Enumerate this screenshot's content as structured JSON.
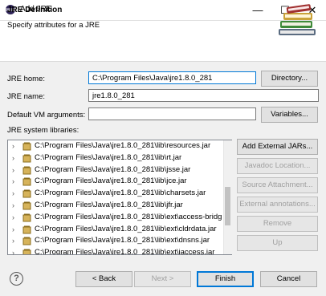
{
  "window": {
    "title": "Add JRE",
    "minimize_glyph": "—",
    "maximize_glyph": "☐",
    "close_glyph": "✕"
  },
  "header": {
    "title": "JRE Definition",
    "subtitle": "Specify attributes for a JRE",
    "icon": "library-books-icon"
  },
  "form": {
    "jre_home_label": "JRE home:",
    "jre_home_value": "C:\\Program Files\\Java\\jre1.8.0_281",
    "directory_button": "Directory...",
    "jre_name_label": "JRE name:",
    "jre_name_value": "jre1.8.0_281",
    "vm_args_label": "Default VM arguments:",
    "vm_args_value": "",
    "variables_button": "Variables...",
    "libraries_label": "JRE system libraries:"
  },
  "libraries": [
    "C:\\Program Files\\Java\\jre1.8.0_281\\lib\\resources.jar",
    "C:\\Program Files\\Java\\jre1.8.0_281\\lib\\rt.jar",
    "C:\\Program Files\\Java\\jre1.8.0_281\\lib\\jsse.jar",
    "C:\\Program Files\\Java\\jre1.8.0_281\\lib\\jce.jar",
    "C:\\Program Files\\Java\\jre1.8.0_281\\lib\\charsets.jar",
    "C:\\Program Files\\Java\\jre1.8.0_281\\lib\\jfr.jar",
    "C:\\Program Files\\Java\\jre1.8.0_281\\lib\\ext\\access-bridg",
    "C:\\Program Files\\Java\\jre1.8.0_281\\lib\\ext\\cldrdata.jar",
    "C:\\Program Files\\Java\\jre1.8.0_281\\lib\\ext\\dnsns.jar",
    "C:\\Program Files\\Java\\jre1.8.0_281\\lib\\ext\\jaccess.jar"
  ],
  "side_buttons": {
    "add_external_jars": "Add External JARs...",
    "javadoc_location": "Javadoc Location...",
    "source_attachment": "Source Attachment...",
    "external_annotations": "External annotations...",
    "remove": "Remove",
    "up": "Up"
  },
  "footer": {
    "help_glyph": "?",
    "back": "< Back",
    "next": "Next >",
    "finish": "Finish",
    "cancel": "Cancel"
  },
  "colors": {
    "accent": "#0078d7",
    "dialog_bg": "#f0f0f0",
    "disabled_text": "#a0a0a0"
  }
}
